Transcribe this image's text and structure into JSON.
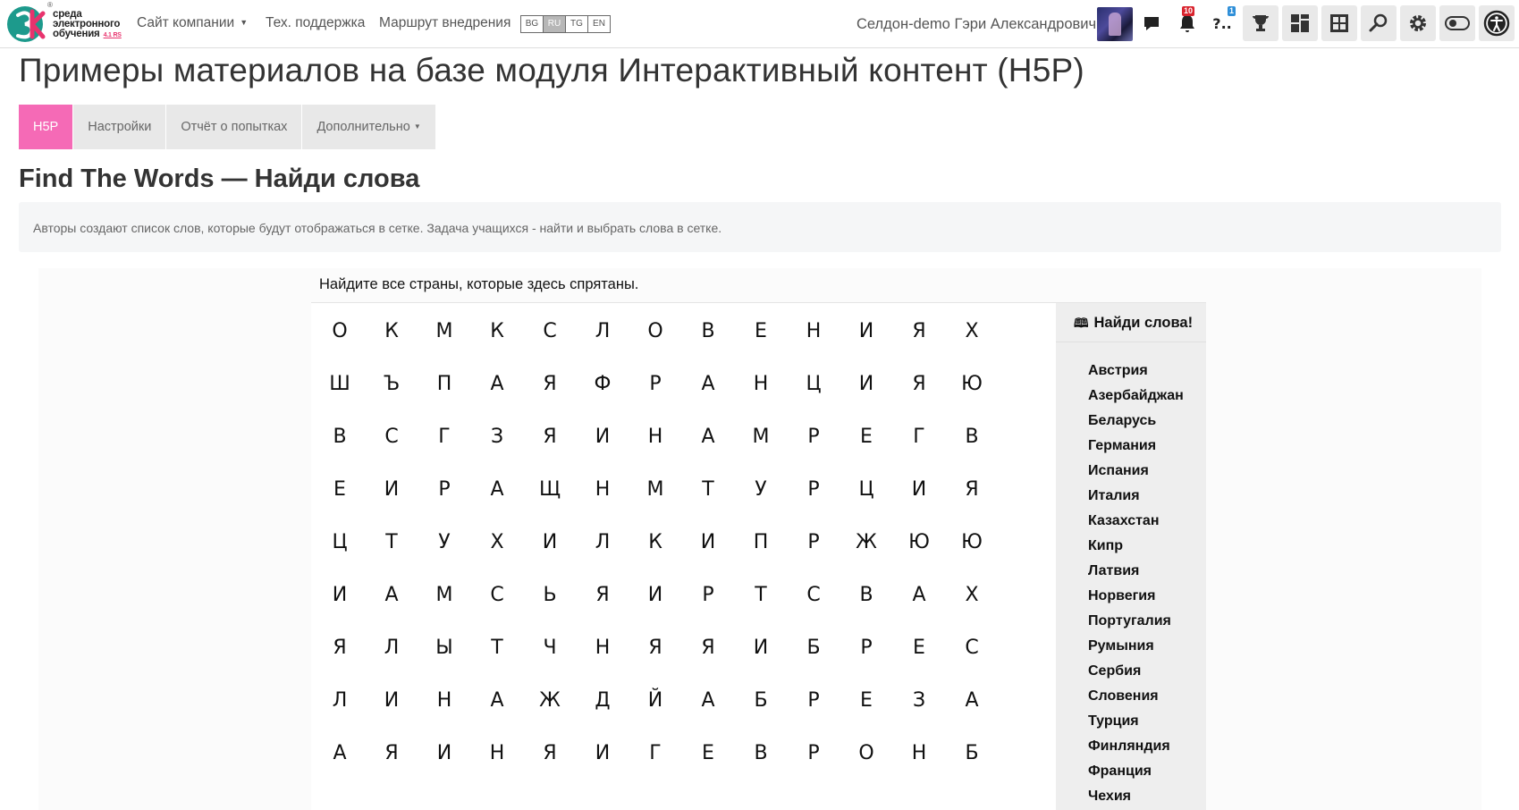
{
  "header": {
    "logo_line1": "среда",
    "logo_line2": "электронного",
    "logo_line3": "обучения",
    "logo_version": "4.1 RS",
    "nav": [
      "Сайт компании",
      "Тех. поддержка",
      "Маршрут внедрения"
    ],
    "languages": [
      {
        "code": "BG",
        "active": false
      },
      {
        "code": "RU",
        "active": true
      },
      {
        "code": "TG",
        "active": false
      },
      {
        "code": "EN",
        "active": false
      }
    ],
    "user_name": "Селдон-demo Гэри Александрович",
    "notifications_count": "10",
    "questions_count": "1",
    "icons": [
      "chat-icon",
      "bell-icon",
      "question-icon",
      "trophy-icon",
      "dashboard-icon",
      "portfolio-icon",
      "search-icon",
      "gear-icon",
      "toggle-icon",
      "accessibility-icon"
    ]
  },
  "page": {
    "title": "Примеры материалов на базе модуля Интерактивный контент (H5P)",
    "tabs": [
      {
        "label": "H5P",
        "active": true
      },
      {
        "label": "Настройки",
        "active": false
      },
      {
        "label": "Отчёт о попытках",
        "active": false
      },
      {
        "label": "Дополнительно",
        "active": false
      }
    ],
    "section_title": "Find The Words — Найди слова",
    "intro": "Авторы создают список слов, которые будут отображаться в сетке. Задача учащихся - найти и выбрать слова в сетке."
  },
  "game": {
    "task": "Найдите все страны, которые здесь спрятаны.",
    "grid": [
      [
        "О",
        "К",
        "М",
        "К",
        "С",
        "Л",
        "О",
        "В",
        "Е",
        "Н",
        "И",
        "Я",
        "Х"
      ],
      [
        "Ш",
        "Ъ",
        "П",
        "А",
        "Я",
        "Ф",
        "Р",
        "А",
        "Н",
        "Ц",
        "И",
        "Я",
        "Ю"
      ],
      [
        "В",
        "С",
        "Г",
        "З",
        "Я",
        "И",
        "Н",
        "А",
        "М",
        "Р",
        "Е",
        "Г",
        "В"
      ],
      [
        "Е",
        "И",
        "Р",
        "А",
        "Щ",
        "Н",
        "М",
        "Т",
        "У",
        "Р",
        "Ц",
        "И",
        "Я"
      ],
      [
        "Ц",
        "Т",
        "У",
        "Х",
        "И",
        "Л",
        "К",
        "И",
        "П",
        "Р",
        "Ж",
        "Ю",
        "Ю"
      ],
      [
        "И",
        "А",
        "М",
        "С",
        "Ь",
        "Я",
        "И",
        "Р",
        "Т",
        "С",
        "В",
        "А",
        "Х"
      ],
      [
        "Я",
        "Л",
        "Ы",
        "Т",
        "Ч",
        "Н",
        "Я",
        "Я",
        "И",
        "Б",
        "Р",
        "Е",
        "С"
      ],
      [
        "Л",
        "И",
        "Н",
        "А",
        "Ж",
        "Д",
        "Й",
        "А",
        "Б",
        "Р",
        "Е",
        "З",
        "А"
      ],
      [
        "А",
        "Я",
        "И",
        "Н",
        "Я",
        "И",
        "Г",
        "Е",
        "В",
        "Р",
        "О",
        "Н",
        "Б"
      ]
    ],
    "wordlist_title": "Найди слова!",
    "words": [
      "Австрия",
      "Азербайджан",
      "Беларусь",
      "Германия",
      "Испания",
      "Италия",
      "Казахстан",
      "Кипр",
      "Латвия",
      "Норвегия",
      "Португалия",
      "Румыния",
      "Сербия",
      "Словения",
      "Турция",
      "Финляндия",
      "Франция",
      "Чехия"
    ]
  },
  "colors": {
    "accent_tab": "#f56ab6",
    "logo_teal": "#1d9a8c",
    "logo_pink": "#e8336d",
    "badge_red": "#d9232d",
    "badge_blue": "#2f8fd8"
  }
}
